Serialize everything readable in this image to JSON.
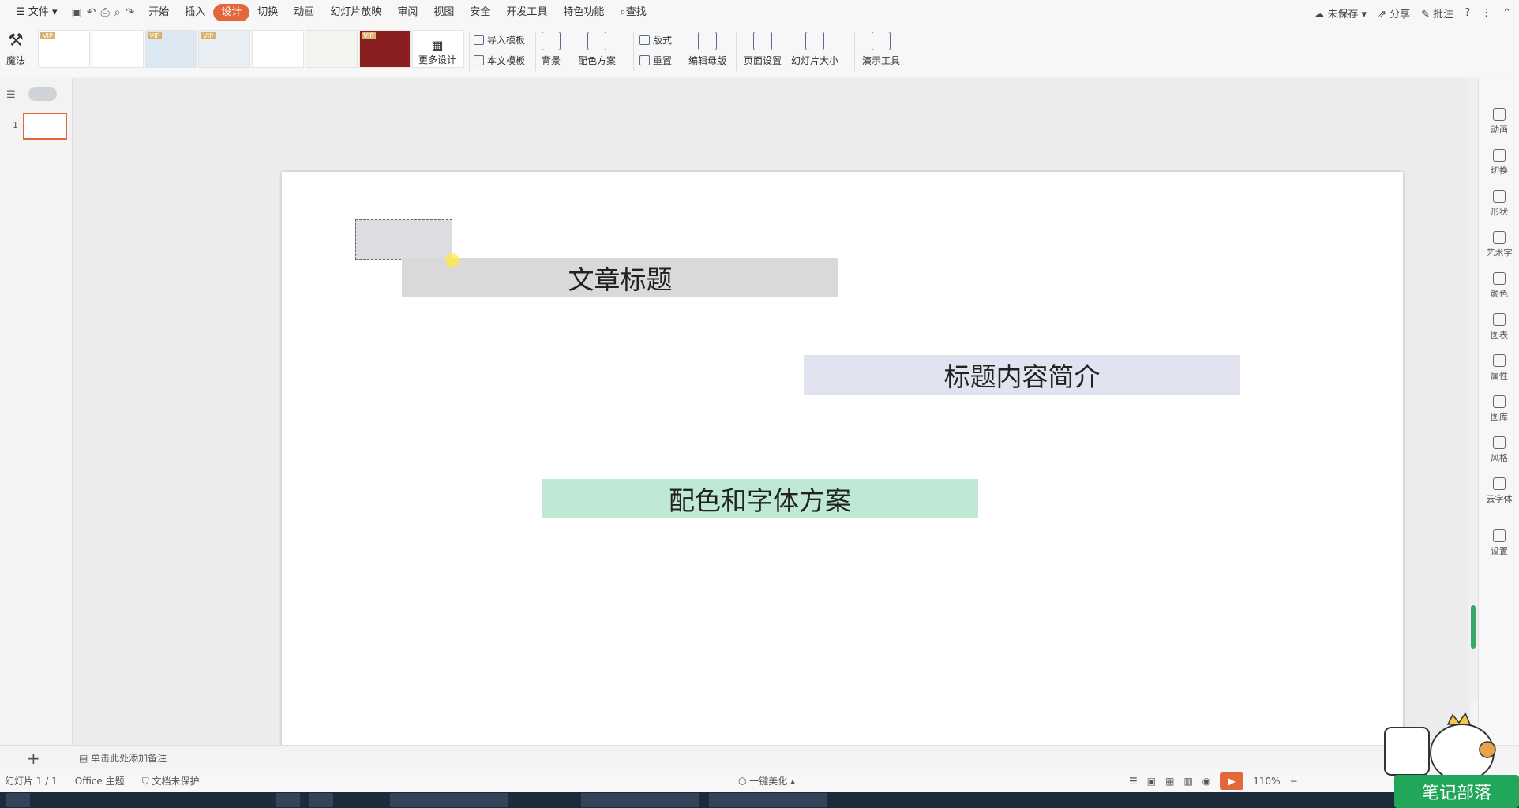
{
  "menubar": {
    "file": "文件",
    "tabs": [
      "开始",
      "插入",
      "设计",
      "切换",
      "动画",
      "幻灯片放映",
      "审阅",
      "视图",
      "安全",
      "开发工具",
      "特色功能"
    ],
    "active_tab": "设计",
    "search": "查找",
    "unsaved": "未保存",
    "share": "分享",
    "comment": "批注"
  },
  "ribbon": {
    "magic": "魔法",
    "more_design": "更多设计",
    "import_template": "导入模板",
    "this_template": "本文模板",
    "background": "背景",
    "color_scheme": "配色方案",
    "layout": "版式",
    "reset": "重置",
    "edit_master": "编辑母版",
    "page_setup": "页面设置",
    "slide_size": "幻灯片大小",
    "presenter_tools": "演示工具"
  },
  "left_panel": {
    "slide_number": "1"
  },
  "slide": {
    "title": "文章标题",
    "intro": "标题内容简介",
    "scheme": "配色和字体方案",
    "colors": {
      "title_bg": "#d9d9d9",
      "intro_bg": "#e2e3f1",
      "scheme_bg": "#bfe9d4"
    }
  },
  "right_panel": [
    "动画",
    "切换",
    "形状",
    "艺术字",
    "颜色",
    "图表",
    "属性",
    "图库",
    "风格",
    "云字体",
    "设置"
  ],
  "notes": {
    "placeholder": "单击此处添加备注"
  },
  "status": {
    "slide_count": "幻灯片 1 / 1",
    "theme": "Office 主题",
    "protection": "文档未保护",
    "beautify": "一键美化",
    "zoom": "110%"
  },
  "watermark": "笔记部落",
  "accent_color": "#e2683c"
}
